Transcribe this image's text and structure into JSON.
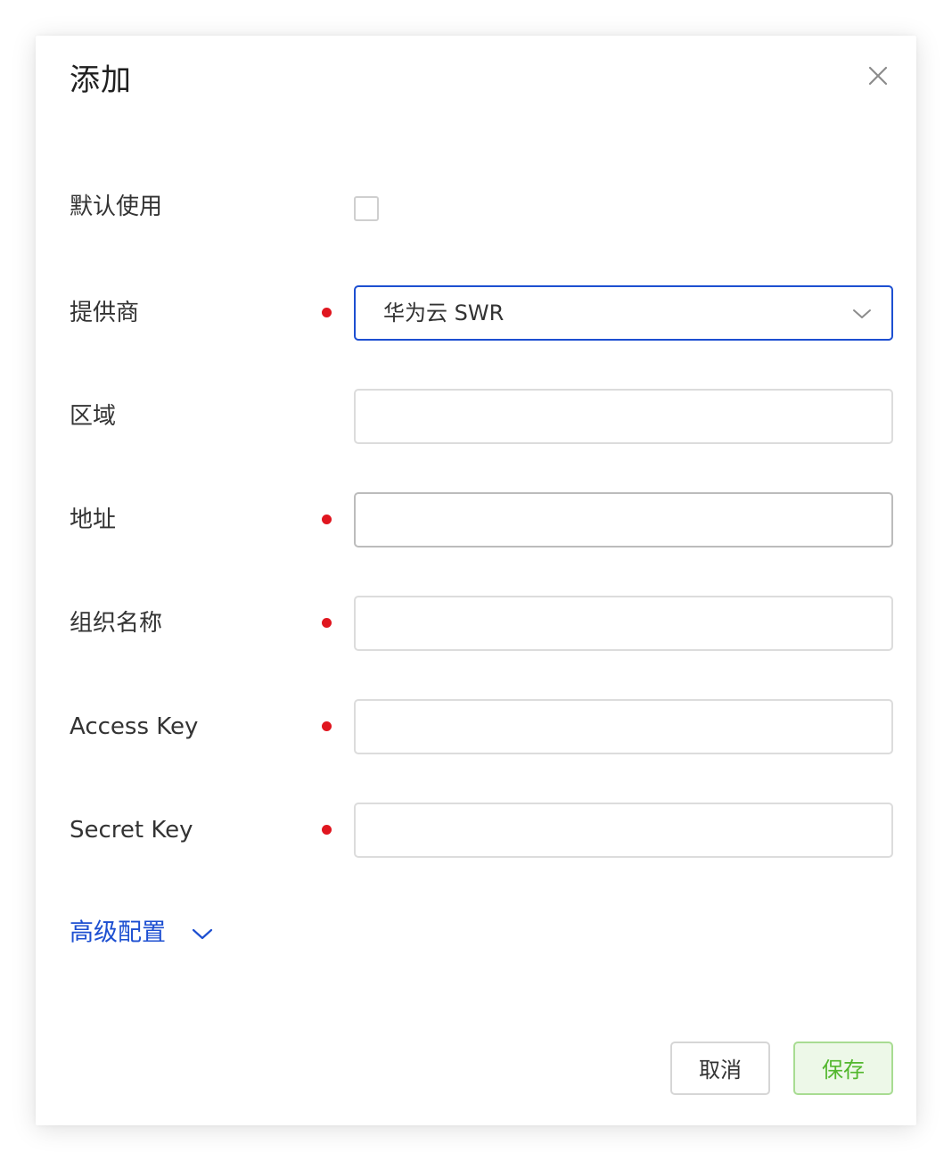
{
  "dialog": {
    "title": "添加",
    "close_icon": "close-icon"
  },
  "form": {
    "default_use": {
      "label": "默认使用",
      "checked": false
    },
    "provider": {
      "label": "提供商",
      "required": true,
      "value": "华为云 SWR"
    },
    "region": {
      "label": "区域",
      "required": false,
      "value": ""
    },
    "address": {
      "label": "地址",
      "required": true,
      "value": ""
    },
    "org_name": {
      "label": "组织名称",
      "required": true,
      "value": ""
    },
    "access_key": {
      "label": "Access Key",
      "required": true,
      "value": ""
    },
    "secret_key": {
      "label": "Secret Key",
      "required": true,
      "value": ""
    }
  },
  "advanced": {
    "label": "高级配置"
  },
  "footer": {
    "cancel_label": "取消",
    "save_label": "保存"
  },
  "colors": {
    "accent": "#1d4fd1",
    "required": "#e0161f",
    "save_text": "#52b72d",
    "save_bg": "#edf8e8"
  }
}
